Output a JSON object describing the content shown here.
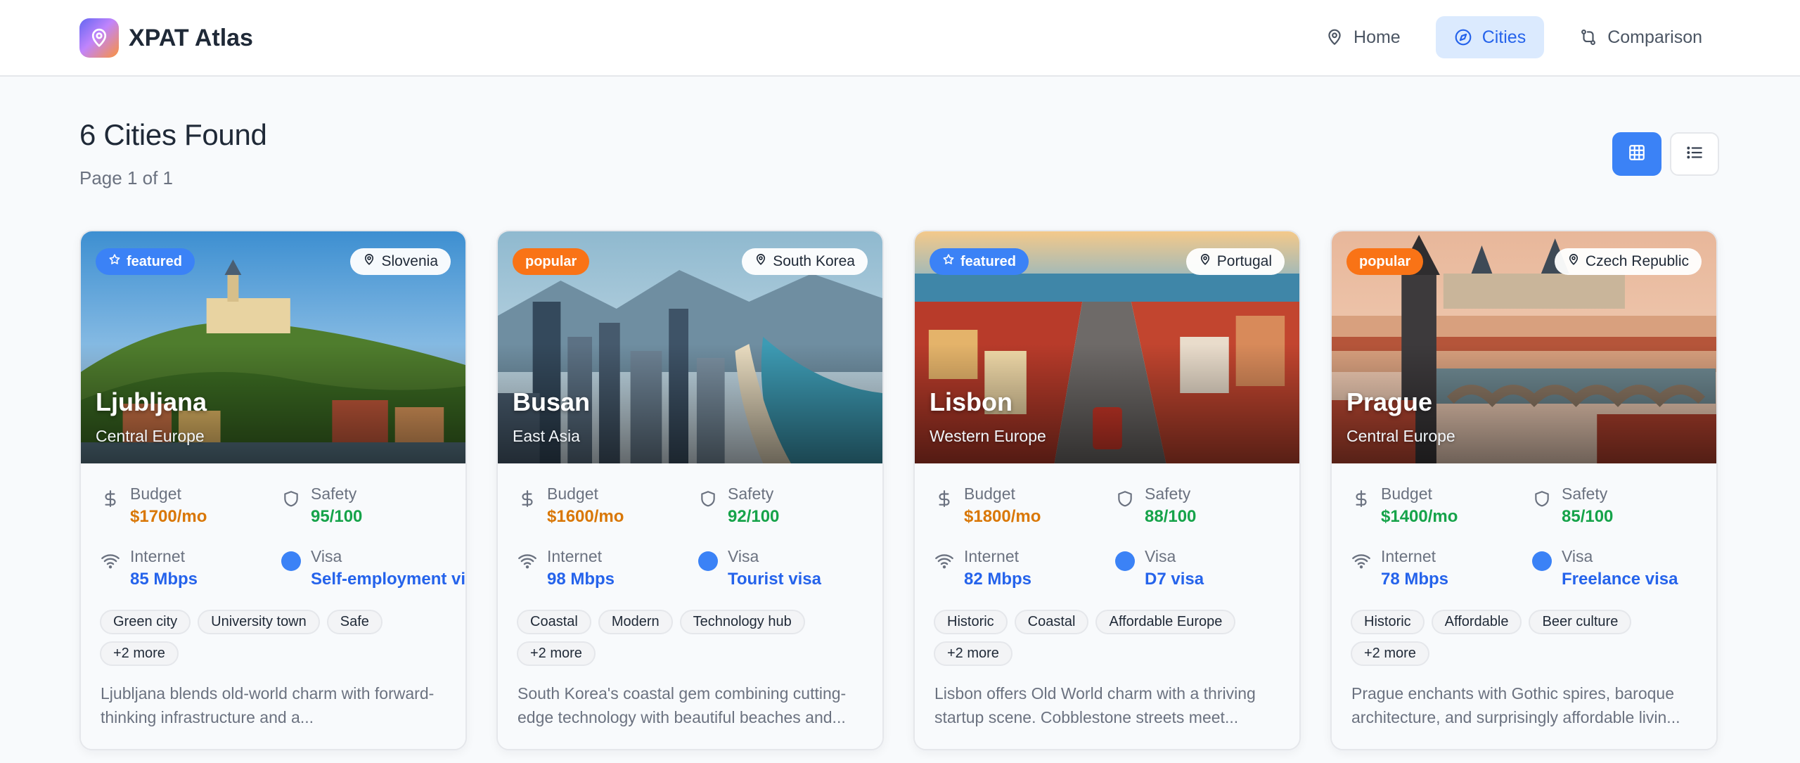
{
  "app": {
    "title": "XPAT Atlas",
    "logo_icon": "map-pin-icon"
  },
  "nav": {
    "items": [
      {
        "label": "Home",
        "icon": "map-pin-icon",
        "active": false
      },
      {
        "label": "Cities",
        "icon": "compass-icon",
        "active": true
      },
      {
        "label": "Comparison",
        "icon": "route-icon",
        "active": false
      }
    ]
  },
  "results": {
    "title": "6 Cities Found",
    "page": "Page 1 of 1",
    "view_modes": [
      {
        "name": "grid",
        "icon": "grid-icon",
        "active": true
      },
      {
        "name": "list",
        "icon": "list-icon",
        "active": false
      }
    ]
  },
  "labels": {
    "budget": "Budget",
    "safety": "Safety",
    "internet": "Internet",
    "visa": "Visa"
  },
  "cities": [
    {
      "name": "Ljubljana",
      "region": "Central Europe",
      "country": "Slovenia",
      "tag": "featured",
      "budget": "$1700/mo",
      "budget_color": "#d97706",
      "safety": "95/100",
      "internet": "85 Mbps",
      "visa": "Self-employment visa",
      "chips": [
        "Green city",
        "University town",
        "Safe",
        "+2 more"
      ],
      "description": "Ljubljana blends old-world charm with forward-thinking infrastructure and a..."
    },
    {
      "name": "Busan",
      "region": "East Asia",
      "country": "South Korea",
      "tag": "popular",
      "budget": "$1600/mo",
      "budget_color": "#d97706",
      "safety": "92/100",
      "internet": "98 Mbps",
      "visa": "Tourist visa",
      "chips": [
        "Coastal",
        "Modern",
        "Technology hub",
        "+2 more"
      ],
      "description": "South Korea's coastal gem combining cutting-edge technology with beautiful beaches and..."
    },
    {
      "name": "Lisbon",
      "region": "Western Europe",
      "country": "Portugal",
      "tag": "featured",
      "budget": "$1800/mo",
      "budget_color": "#d97706",
      "safety": "88/100",
      "internet": "82 Mbps",
      "visa": "D7 visa",
      "chips": [
        "Historic",
        "Coastal",
        "Affordable Europe",
        "+2 more"
      ],
      "description": "Lisbon offers Old World charm with a thriving startup scene. Cobblestone streets meet..."
    },
    {
      "name": "Prague",
      "region": "Central Europe",
      "country": "Czech Republic",
      "tag": "popular",
      "budget": "$1400/mo",
      "budget_color": "#16a34a",
      "safety": "85/100",
      "internet": "78 Mbps",
      "visa": "Freelance visa",
      "chips": [
        "Historic",
        "Affordable",
        "Beer culture",
        "+2 more"
      ],
      "description": "Prague enchants with Gothic spires, baroque architecture, and surprisingly affordable livin..."
    }
  ],
  "colors": {
    "accent": "#3b82f6",
    "featured": "#3b82f6",
    "popular": "#f97316",
    "safety": "#16a34a",
    "link": "#2563eb"
  }
}
